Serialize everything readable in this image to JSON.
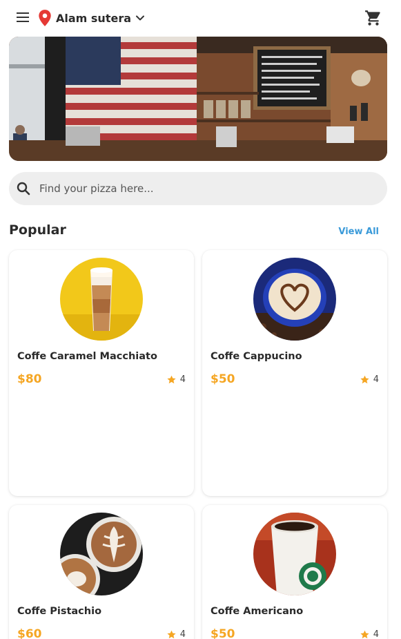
{
  "header": {
    "menu_icon": "menu-icon",
    "location_icon": "location-pin-icon",
    "location_label": "Alam sutera",
    "location_dropdown_icon": "chevron-down-icon",
    "cart_icon": "shopping-cart-icon"
  },
  "banner": {
    "image": "coffee-shop-interior"
  },
  "search": {
    "icon": "search-icon",
    "placeholder": "Find your pizza here..."
  },
  "popular": {
    "title": "Popular",
    "view_all_label": "View All",
    "items": [
      {
        "name": "Coffe Caramel Macchiato",
        "price": "$80",
        "rating": "4",
        "image": "caramel-macchiato-glass"
      },
      {
        "name": "Coffe Cappucino",
        "price": "$50",
        "rating": "4",
        "image": "cappuccino-heart-latte-art"
      },
      {
        "name": "Coffe Pistachio",
        "price": "$60",
        "rating": "4",
        "image": "latte-art-cups"
      },
      {
        "name": "Coffe Americano",
        "price": "$50",
        "rating": "4",
        "image": "paper-cup-coffee"
      }
    ]
  },
  "colors": {
    "price": "#f5a623",
    "star": "#f5a623",
    "pin": "#e53935",
    "link": "#3a9ad9",
    "search_bg": "#eeeeee"
  }
}
